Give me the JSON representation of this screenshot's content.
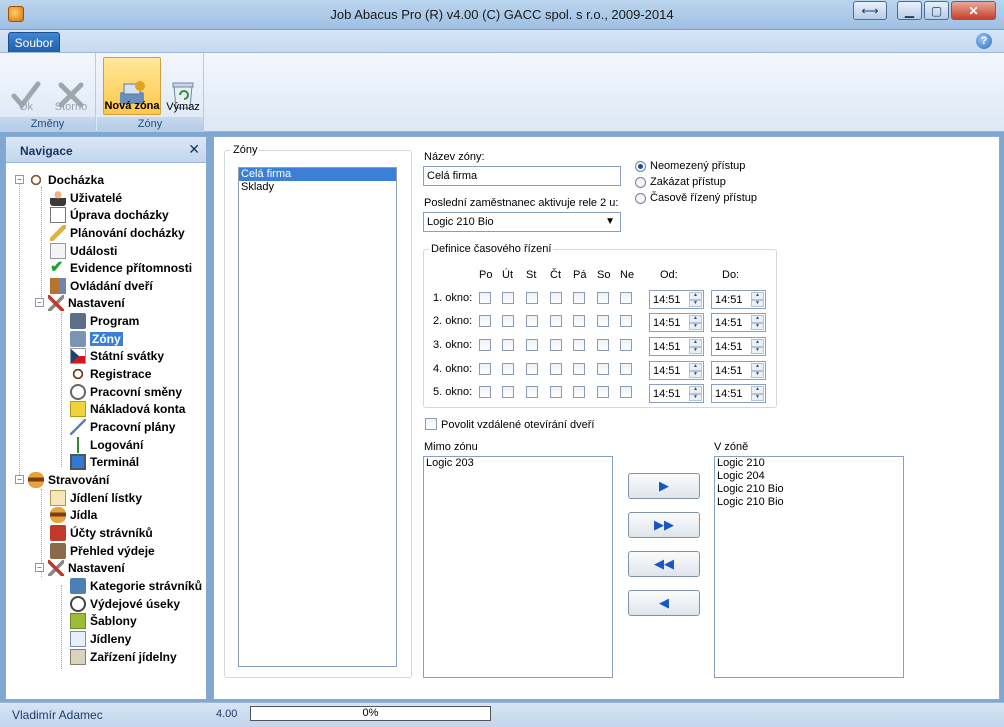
{
  "window": {
    "title": "Job Abacus Pro (R) v4.00 (C) GACC spol. s r.o., 2009-2014"
  },
  "ribbon": {
    "tab_soubor": "Soubor",
    "groups": {
      "zmeny": "Změny",
      "zony": "Zóny"
    },
    "buttons": {
      "ok": "Ok",
      "storno": "Storno",
      "nova_zona": "Nová zóna",
      "vymaz": "Výmaz"
    }
  },
  "nav": {
    "title": "Navigace",
    "items": [
      {
        "label": "Docházka"
      },
      {
        "label": "Uživatelé"
      },
      {
        "label": "Úprava docházky"
      },
      {
        "label": "Plánování docházky"
      },
      {
        "label": "Události"
      },
      {
        "label": "Evidence přítomnosti"
      },
      {
        "label": "Ovládání dveří"
      },
      {
        "label": "Nastavení"
      },
      {
        "label": "Program"
      },
      {
        "label": "Zóny"
      },
      {
        "label": "Státní svátky"
      },
      {
        "label": "Registrace"
      },
      {
        "label": "Pracovní směny"
      },
      {
        "label": "Nákladová konta"
      },
      {
        "label": "Pracovní plány"
      },
      {
        "label": "Logování"
      },
      {
        "label": "Terminál"
      },
      {
        "label": "Stravování"
      },
      {
        "label": "Jídlení lístky"
      },
      {
        "label": "Jídla"
      },
      {
        "label": "Účty strávníků"
      },
      {
        "label": "Přehled výdeje"
      },
      {
        "label": "Nastavení"
      },
      {
        "label": "Kategorie strávníků"
      },
      {
        "label": "Výdejové úseky"
      },
      {
        "label": "Šablony"
      },
      {
        "label": "Jídleny"
      },
      {
        "label": "Zařízení jídelny"
      }
    ]
  },
  "zones": {
    "legend": "Zóny",
    "items": [
      "Celá firma",
      "Sklady"
    ],
    "selected": "Celá firma"
  },
  "form": {
    "name_label": "Název zóny:",
    "name_value": "Celá firma",
    "relay_label": "Poslední zaměstnanec aktivuje rele 2 u:",
    "relay_value": "Logic 210 Bio",
    "access": [
      "Neomezený přístup",
      "Zakázat přístup",
      "Časově řízený přístup"
    ],
    "access_selected": 0,
    "timing_legend": "Definice časového řízení",
    "days": [
      "Po",
      "Út",
      "St",
      "Čt",
      "Pá",
      "So",
      "Ne"
    ],
    "from_label": "Od:",
    "to_label": "Do:",
    "windows": [
      {
        "label": "1. okno:",
        "from": "14:51",
        "to": "14:51"
      },
      {
        "label": "2. okno:",
        "from": "14:51",
        "to": "14:51"
      },
      {
        "label": "3. okno:",
        "from": "14:51",
        "to": "14:51"
      },
      {
        "label": "4. okno:",
        "from": "14:51",
        "to": "14:51"
      },
      {
        "label": "5. okno:",
        "from": "14:51",
        "to": "14:51"
      }
    ],
    "remote_label": "Povolit vzdálené otevírání dveří",
    "outside_label": "Mimo zónu",
    "outside_items": [
      "Logic 203"
    ],
    "inside_label": "V zóně",
    "inside_items": [
      "Logic 210",
      "Logic 204",
      "Logic 210 Bio",
      "Logic 210 Bio"
    ]
  },
  "status": {
    "user": "Vladimír Adamec",
    "version": "4.00",
    "progress_text": "0%",
    "progress": 0
  }
}
